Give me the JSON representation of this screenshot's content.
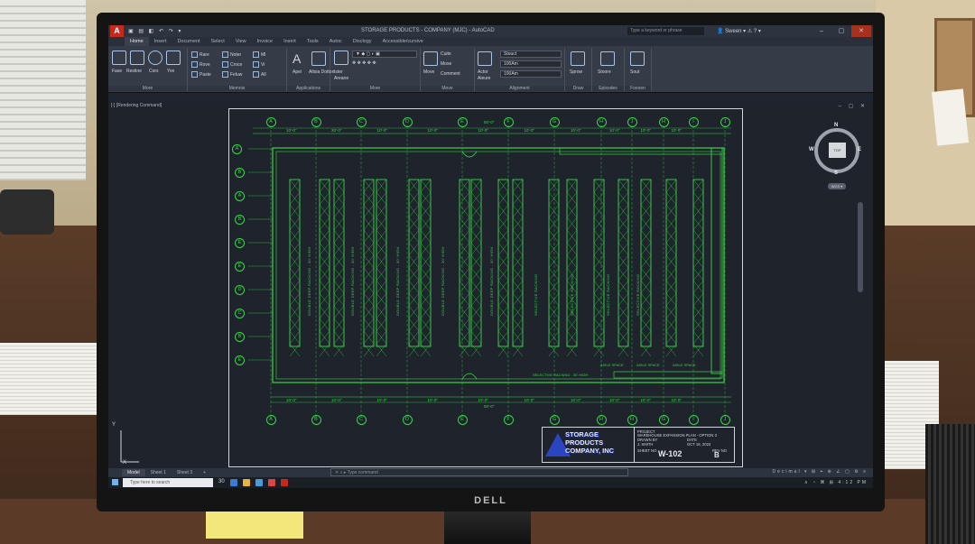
{
  "titlebar": {
    "title": "STORAGE PRODUCTS - COMPANY (MJC) - AutoCAD",
    "quick_access": "▣ ▤ ◧ ↶ ↷ ▾",
    "search_placeholder": "Type a keyword or phrase",
    "user": "Sween",
    "app_letter": "A"
  },
  "ribbon": {
    "tabs": [
      "Home",
      "Insert",
      "Document",
      "Select",
      "View",
      "Invoice",
      "Insert",
      "Tools",
      "Autoc",
      "Disclogy",
      "Accessible/cursive"
    ],
    "active_tab": "Home",
    "panels": [
      {
        "title": "More",
        "tools": [
          "Fase",
          "Restine",
          "Cors",
          "Yve"
        ]
      },
      {
        "title": "Memois",
        "tools": [
          "Rare",
          "Rove",
          "Paste",
          "Noter",
          "Croce",
          "Feluw",
          "Ml",
          "Vi",
          "All"
        ]
      },
      {
        "title": "Applications",
        "tools": [
          "Apei",
          "Altsia Dotton"
        ]
      },
      {
        "title": "More",
        "tools": [
          "Ister",
          "Areane"
        ]
      },
      {
        "title": "Move",
        "tools": [
          "Move",
          "Cuite",
          "Mose",
          "Comment"
        ]
      },
      {
        "title": "Alignment",
        "tools": [
          "Actor",
          "Aieure"
        ],
        "combos": [
          "Stouct",
          "100Am",
          "100Am"
        ]
      },
      {
        "title": "Draw",
        "tools": [
          "Sprow"
        ]
      },
      {
        "title": "Episodes",
        "tools": [
          "Stoore"
        ]
      },
      {
        "title": "Fosoen",
        "tools": [
          "Sout"
        ]
      }
    ]
  },
  "drawing": {
    "command_label": "[-] [Rendering Command]",
    "viewport_controls": "– ▢ ✕",
    "columns_top": [
      "A",
      "B",
      "C",
      "D",
      "E",
      "F",
      "G",
      "H",
      "J",
      "H",
      "I",
      "J"
    ],
    "columns_bottom": [
      "A",
      "B",
      "C",
      "D",
      "E",
      "F",
      "G",
      "H",
      "H",
      "G",
      "I",
      "J"
    ],
    "rows_left": [
      "A",
      "B",
      "A",
      "B",
      "E",
      "E",
      "D",
      "C",
      "B",
      "E"
    ],
    "dims_top": [
      "10'-0\"",
      "30'-0\"",
      "10'-0\"",
      "10'-0\"",
      "10'-0\"",
      "10'-0\"",
      "10'-0\"",
      "10'-0\"",
      "10'-0\"",
      "10'-0\""
    ],
    "dim_overall_top": "50'-0\"",
    "dims_bottom": [
      "10'-0\"",
      "10'-0\"",
      "10'-0\"",
      "10'-0\"",
      "10'-0\"",
      "10'-0\"",
      "10'-0\"",
      "10'-0\"",
      "10'-0\"",
      "10'-0\""
    ],
    "dim_overall_bottom": "50'-0\"",
    "rack_labels": [
      "DOUBLE DEEP RACKING - 30' HIGH",
      "DOUBLE DEEP RACKING - 30' HIGH",
      "DOUBLE DEEP RACKING - 30' HIGH",
      "DOUBLE DEEP RACKING - 30' HIGH",
      "DOUBLE DEEP RACKING - 30' HIGH",
      "SELECTIVE RACKING",
      "SELECTIVE RACKING",
      "SELECTIVE RACKING",
      "SELECTIVE RACKING"
    ],
    "aisle_notes": [
      "AISLE SPACE",
      "AISLE SPACE",
      "AISLE SPACE"
    ],
    "bottom_note": "SELECTIVE RACKING - 30' HIGH",
    "viewcube": {
      "face": "TOP",
      "north": "N",
      "south": "S",
      "east": "E",
      "west": "W",
      "wcs": "WCS ▾"
    },
    "ucs_x": "X",
    "ucs_y": "Y"
  },
  "titleblock": {
    "company": "STORAGE PRODUCTS COMPANY, INC",
    "project_label": "PROJECT",
    "project": "WAREHOUSE EXPANSION PLAN - OPTION 3",
    "drawn_label": "DRAWN BY",
    "drawn": "J. SMITH",
    "date_label": "DATE",
    "date": "OCT 18, 2023",
    "sheet_label": "SHEET NO",
    "sheet": "W-102",
    "rev_label": "REV NO",
    "rev": "B"
  },
  "layout_tabs": [
    "Model",
    "Sheet 1",
    "Sheet 3",
    "+"
  ],
  "active_layout": "Model",
  "command_placeholder": "✕ ⌕ ▸ Type command",
  "status_bar": "Decimal ▾ ⊞ ⌖ ⊕ ∠ ▢ ⚙ ≡",
  "taskbar": {
    "search": "Type here to search",
    "temp": "30",
    "tray": "∧ ◔ ⌘ ⊞ 4:12 PM"
  },
  "monitor_brand": "DELL",
  "colors": {
    "cad_green": "#39d64a",
    "background": "#1e232c",
    "accent_red": "#c5281c"
  }
}
